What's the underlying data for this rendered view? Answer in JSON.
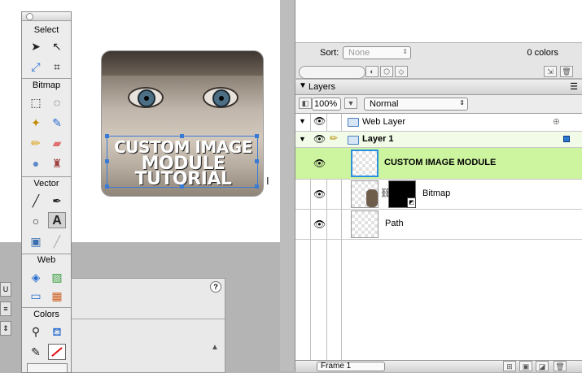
{
  "canvas": {
    "module_text": [
      "CUSTOM IMAGE",
      "MODULE",
      "TUTORIAL"
    ]
  },
  "tools": {
    "sections": [
      "Select",
      "Bitmap",
      "Vector",
      "Web",
      "Colors"
    ],
    "icons": {
      "pointer": "pointer-icon",
      "subselect": "subselect-icon",
      "scale": "scale-icon",
      "crop": "crop-icon",
      "marquee": "marquee-icon",
      "lasso": "lasso-icon",
      "magic_wand": "magic-wand-icon",
      "brush": "brush-icon",
      "pencil": "pencil-icon",
      "eraser": "eraser-icon",
      "blur": "blur-icon",
      "rubber_stamp": "rubber-stamp-icon",
      "line": "line-icon",
      "pen": "pen-icon",
      "ellipse": "ellipse-icon",
      "text": "text-icon",
      "freeform": "freeform-icon",
      "knife": "knife-icon",
      "hotspot": "hotspot-icon",
      "slice": "slice-icon",
      "hide_slices": "hide-slices-icon",
      "show_slices": "show-slices-icon",
      "eyedropper": "eyedropper-icon",
      "paint_bucket": "paint-bucket-icon",
      "stroke_color": "stroke-color-icon",
      "fill_color": "fill-color-icon"
    },
    "text_tool_glyph": "A"
  },
  "optimize": {
    "sort_label": "Sort:",
    "sort_value": "None",
    "colors_count": "0 colors"
  },
  "layers": {
    "title": "Layers",
    "opacity": "100%",
    "blend_mode": "Normal",
    "rows": [
      {
        "name": "Web Layer"
      },
      {
        "name": "Layer 1"
      },
      {
        "name": "CUSTOM IMAGE MODULE"
      },
      {
        "name": "Bitmap"
      },
      {
        "name": "Path"
      }
    ],
    "frame": "Frame 1",
    "accent": "#cdf5a0"
  }
}
